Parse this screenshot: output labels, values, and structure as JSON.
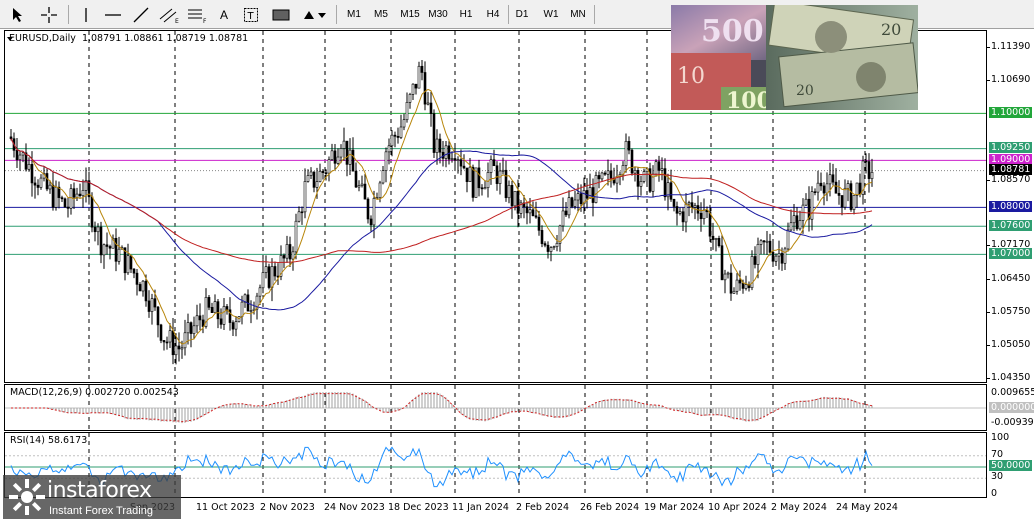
{
  "toolbar": {
    "tools": [
      {
        "name": "cursor-icon",
        "glyph": "↖"
      },
      {
        "name": "crosshair-icon",
        "glyph": "+"
      },
      {
        "name": "vertical-line-icon",
        "glyph": "|"
      },
      {
        "name": "horizontal-line-icon",
        "glyph": "—"
      },
      {
        "name": "trendline-icon",
        "glyph": "╱"
      },
      {
        "name": "equidistant-channel-icon",
        "glyph": "≠"
      },
      {
        "name": "fibonacci-icon",
        "glyph": "≡"
      },
      {
        "name": "text-icon",
        "glyph": "A"
      },
      {
        "name": "text-label-icon",
        "glyph": "T"
      },
      {
        "name": "rectangle-icon",
        "glyph": "▬"
      },
      {
        "name": "arrows-icon",
        "glyph": "⇅"
      }
    ],
    "timeframes": [
      "M1",
      "M5",
      "M15",
      "M30",
      "H1",
      "H4",
      "D1",
      "W1",
      "MN"
    ]
  },
  "main": {
    "title": "EURUSD,Daily  1.08791 1.08861 1.08719 1.08781",
    "price_ticks": [
      "1.11390",
      "1.10690",
      "1.08570",
      "1.07170",
      "1.06450",
      "1.05750",
      "1.05050",
      "1.04350"
    ],
    "price_levels": [
      {
        "label": "1.10000",
        "value": 1.1,
        "color": "#22a63a"
      },
      {
        "label": "1.09250",
        "value": 1.0925,
        "color": "#2f9e72"
      },
      {
        "label": "1.09000",
        "value": 1.09,
        "color": "#cc22cc"
      },
      {
        "label": "1.08781",
        "value": 1.08781,
        "color": "#000000"
      },
      {
        "label": "1.08000",
        "value": 1.08,
        "color": "#1a1aa0"
      },
      {
        "label": "1.07600",
        "value": 1.076,
        "color": "#2f9e72"
      },
      {
        "label": "1.07000",
        "value": 1.07,
        "color": "#2f9e72"
      }
    ]
  },
  "macd": {
    "title": "MACD(12,26,9) 0.002720 0.002543",
    "ticks": [
      "0.009655",
      "0.000000",
      "-0.009392"
    ]
  },
  "rsi": {
    "title": "RSI(14) 58.6173",
    "ticks": [
      "100",
      "70",
      "50.0000",
      "30",
      "0"
    ]
  },
  "time_axis": {
    "labels": [
      "Sep 2023",
      "11 Oct 2023",
      "2 Nov 2023",
      "24 Nov 2023",
      "18 Dec 2023",
      "11 Jan 2024",
      "2 Feb 2024",
      "26 Feb 2024",
      "19 Mar 2024",
      "10 Apr 2024",
      "2 May 2024",
      "24 May 2024"
    ]
  },
  "logo": {
    "brand": "instaforex",
    "tagline": "Instant Forex Trading"
  },
  "colors": {
    "candles": "#000000",
    "ma_fast": "#b8860b",
    "ma_slow": "#1a1aa0",
    "ma_long": "#c02020",
    "macd_hist": "#a0a0a0",
    "macd_signal": "#d02020",
    "rsi_line": "#1e90ff",
    "grid": "#000000"
  }
}
